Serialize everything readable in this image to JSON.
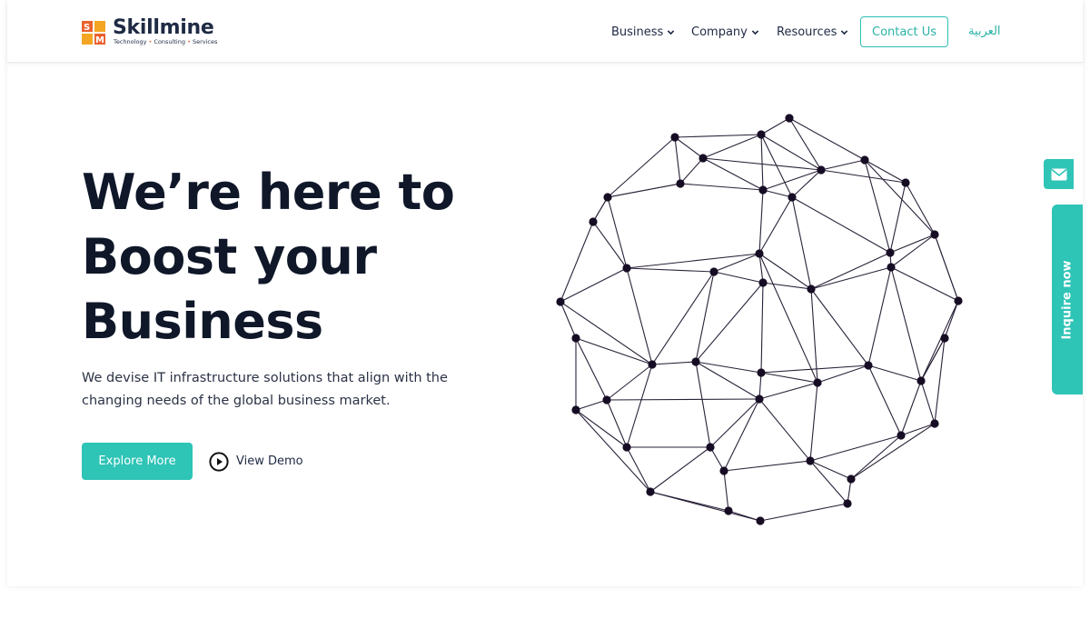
{
  "brand": {
    "name": "Skillmine",
    "tagline": [
      "Technology",
      "Consulting",
      "Services"
    ],
    "colors": {
      "accent": "#2ec4b6",
      "logo_orange": "#e9612c",
      "heading": "#0f1729"
    }
  },
  "nav": {
    "items": [
      {
        "label": "Business",
        "icon": "chevron-down-icon"
      },
      {
        "label": "Company",
        "icon": "chevron-down-icon"
      },
      {
        "label": "Resources",
        "icon": "chevron-down-icon"
      }
    ],
    "contact_label": "Contact Us",
    "language_label": "العربية"
  },
  "hero": {
    "headline_lines": [
      "We’re here to",
      "Boost your",
      "Business"
    ],
    "subtext_lines": [
      "We devise IT infrastructure solutions that align with the",
      "changing needs of the global business market."
    ],
    "primary_cta": "Explore More",
    "secondary_cta": "View Demo",
    "secondary_icon": "play-circle-icon",
    "illustration": "network-globe"
  },
  "floating": {
    "mail_icon": "envelope-icon",
    "inquire_label": "Inquire now"
  }
}
